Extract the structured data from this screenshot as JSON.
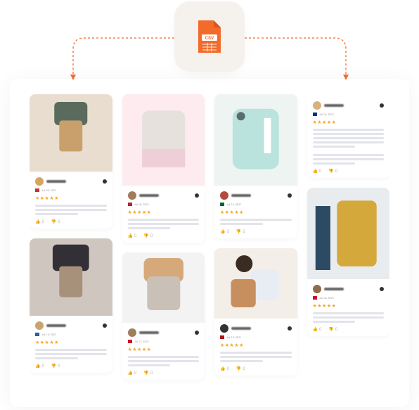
{
  "csv_badge": {
    "label": "CSV"
  },
  "diagram": {
    "description": "CSV import distributing product reviews into a review board"
  },
  "stars_glyph": "★★★★★",
  "cards": [
    {
      "id": "c1",
      "has_image": true,
      "thumb_color": "#e8ddcf",
      "bag": "#c9a06b",
      "avatar": "#d8a35c",
      "date": "Jul 20, 2021",
      "like": "0",
      "dislike": "0"
    },
    {
      "id": "c2",
      "has_image": true,
      "thumb_color": "#cfc6bf",
      "bag": "#a8917a",
      "avatar": "#caa46f",
      "date": "Jul 19, 2021",
      "like": "0",
      "dislike": "0"
    },
    {
      "id": "c3",
      "has_image": true,
      "thumb_color": "#fdebef",
      "bag": "#e6e1dc",
      "avatar": "#a27b5c",
      "date": "Jul 18, 2021",
      "like": "0",
      "dislike": "0"
    },
    {
      "id": "c4",
      "has_image": true,
      "thumb_color": "#f3f3f3",
      "bag": "#c9c1b7",
      "avatar": "#9e7e5b",
      "date": "Jul 17, 2021",
      "like": "0",
      "dislike": "0"
    },
    {
      "id": "c5",
      "has_image": true,
      "thumb_color": "#eef4f2",
      "bag": "#b9e3dc",
      "avatar": "#b04b3e",
      "date": "Jul 16, 2021",
      "like": "0",
      "dislike": "0"
    },
    {
      "id": "c6",
      "has_image": true,
      "thumb_color": "#f4eee8",
      "bag": "#e7edf2",
      "avatar": "#333333",
      "date": "Jul 15, 2021",
      "like": "0",
      "dislike": "0"
    },
    {
      "id": "c7",
      "has_image": false,
      "thumb_color": "",
      "bag": "",
      "avatar": "#d9b27a",
      "date": "Jul 14, 2021",
      "like": "0",
      "dislike": "0"
    },
    {
      "id": "c8",
      "has_image": true,
      "thumb_color": "#e8ecef",
      "bag": "#d4a83a",
      "avatar": "#8e6d4a",
      "date": "Jul 13, 2021",
      "like": "0",
      "dislike": "0"
    }
  ],
  "colors": {
    "accent": "#f26b2b",
    "star": "#f5a623",
    "board_bg": "#ffffff",
    "card_bg": "#f5f6fb"
  }
}
